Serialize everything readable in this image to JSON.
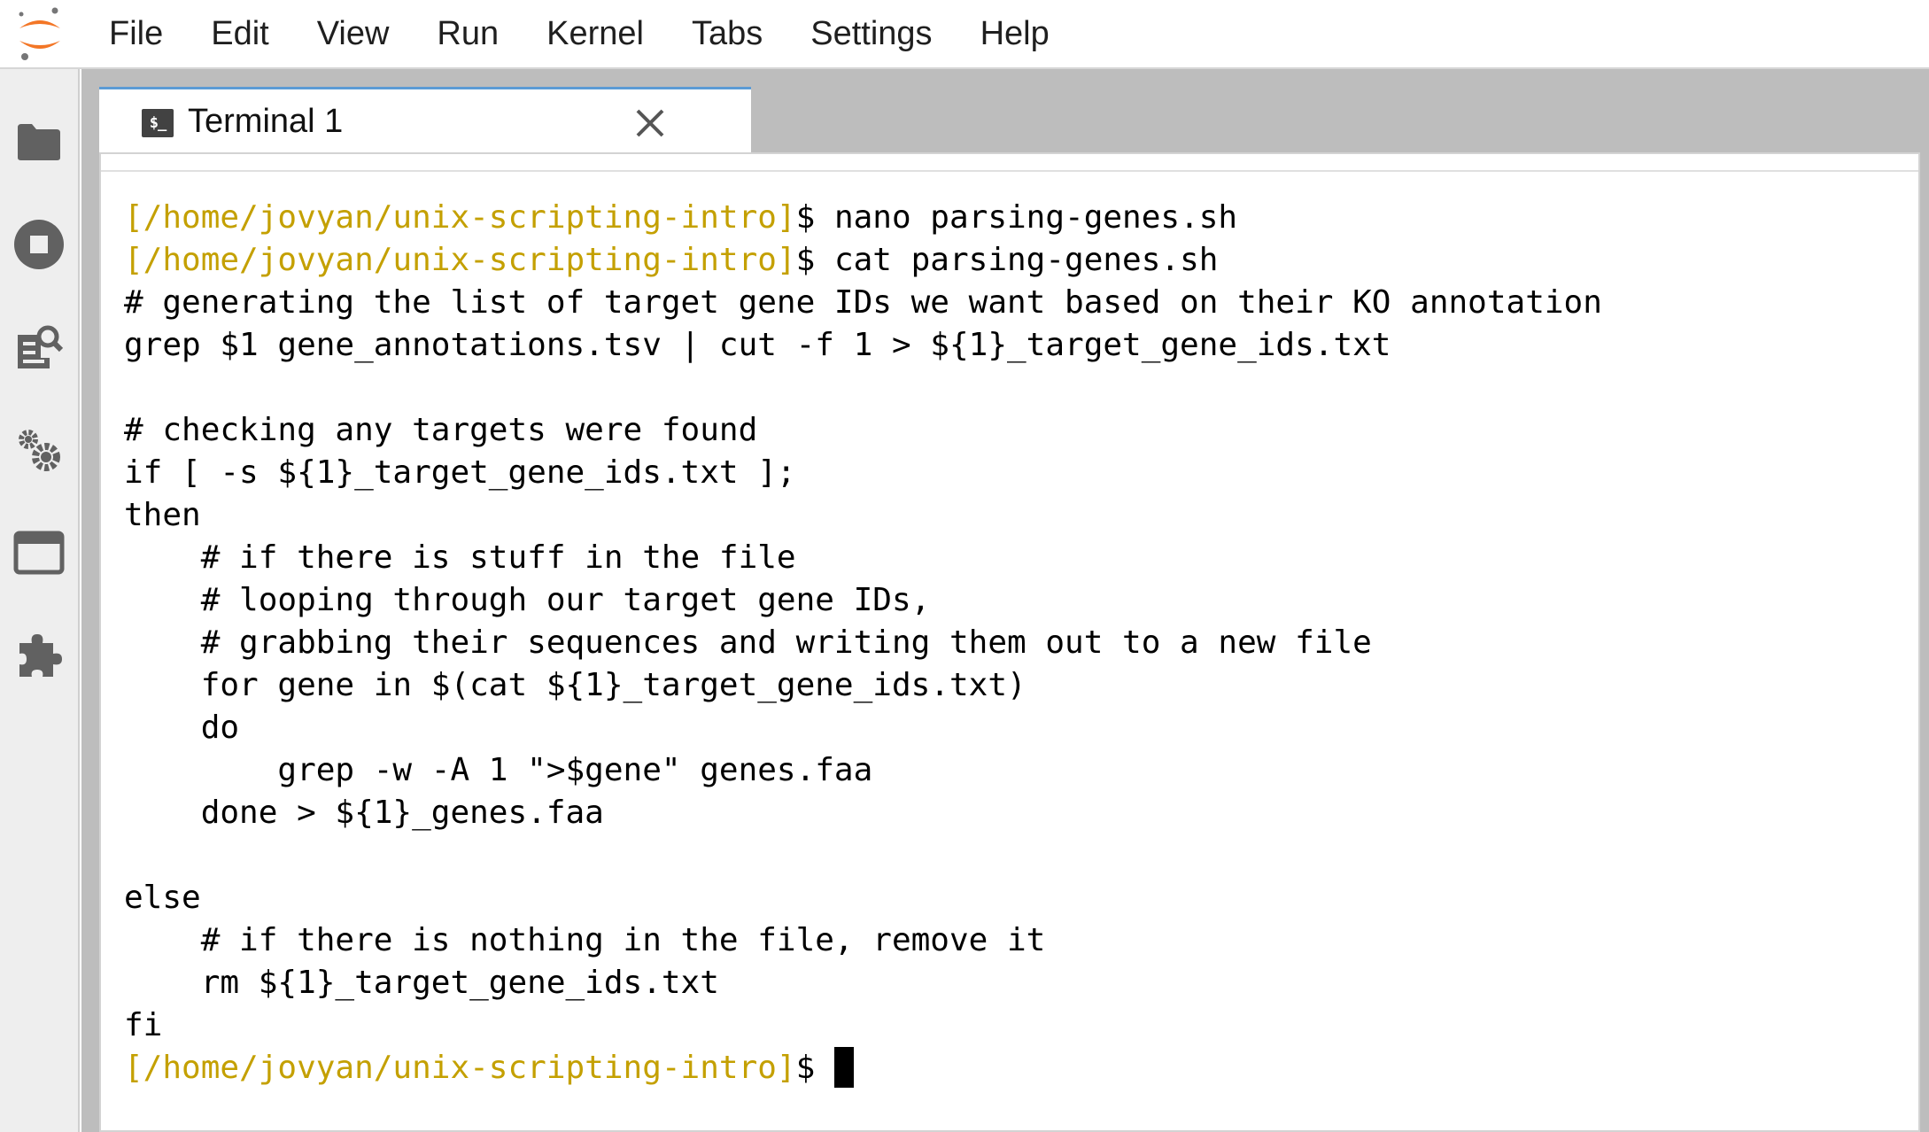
{
  "menubar": {
    "items": [
      "File",
      "Edit",
      "View",
      "Run",
      "Kernel",
      "Tabs",
      "Settings",
      "Help"
    ]
  },
  "sidebar": {
    "icons": [
      "folder-icon",
      "running-stop-icon",
      "property-inspector-icon",
      "settings-gears-icon",
      "tabs-window-icon",
      "extensions-puzzle-icon"
    ]
  },
  "tab": {
    "icon_text": "$_",
    "title": "Terminal 1"
  },
  "colors": {
    "prompt": "#c4a000",
    "tab_accent": "#5b9bd5"
  },
  "terminal": {
    "prompt": "[/home/jovyan/unix-scripting-intro]",
    "prompt_symbol": "$",
    "lines": [
      {
        "prompt": "[/home/jovyan/unix-scripting-intro]",
        "text": "$ nano parsing-genes.sh"
      },
      {
        "prompt": "[/home/jovyan/unix-scripting-intro]",
        "text": "$ cat parsing-genes.sh"
      },
      {
        "prompt": "",
        "text": "# generating the list of target gene IDs we want based on their KO annotation"
      },
      {
        "prompt": "",
        "text": "grep $1 gene_annotations.tsv | cut -f 1 > ${1}_target_gene_ids.txt"
      },
      {
        "prompt": "",
        "text": ""
      },
      {
        "prompt": "",
        "text": "# checking any targets were found"
      },
      {
        "prompt": "",
        "text": "if [ -s ${1}_target_gene_ids.txt ];"
      },
      {
        "prompt": "",
        "text": "then"
      },
      {
        "prompt": "",
        "text": "    # if there is stuff in the file"
      },
      {
        "prompt": "",
        "text": "    # looping through our target gene IDs,"
      },
      {
        "prompt": "",
        "text": "    # grabbing their sequences and writing them out to a new file"
      },
      {
        "prompt": "",
        "text": "    for gene in $(cat ${1}_target_gene_ids.txt)"
      },
      {
        "prompt": "",
        "text": "    do"
      },
      {
        "prompt": "",
        "text": "        grep -w -A 1 \">$gene\" genes.faa"
      },
      {
        "prompt": "",
        "text": "    done > ${1}_genes.faa"
      },
      {
        "prompt": "",
        "text": ""
      },
      {
        "prompt": "",
        "text": "else"
      },
      {
        "prompt": "",
        "text": "    # if there is nothing in the file, remove it"
      },
      {
        "prompt": "",
        "text": "    rm ${1}_target_gene_ids.txt"
      },
      {
        "prompt": "",
        "text": "fi"
      }
    ],
    "final_prompt": "[/home/jovyan/unix-scripting-intro]",
    "final_prompt_symbol": "$ "
  }
}
